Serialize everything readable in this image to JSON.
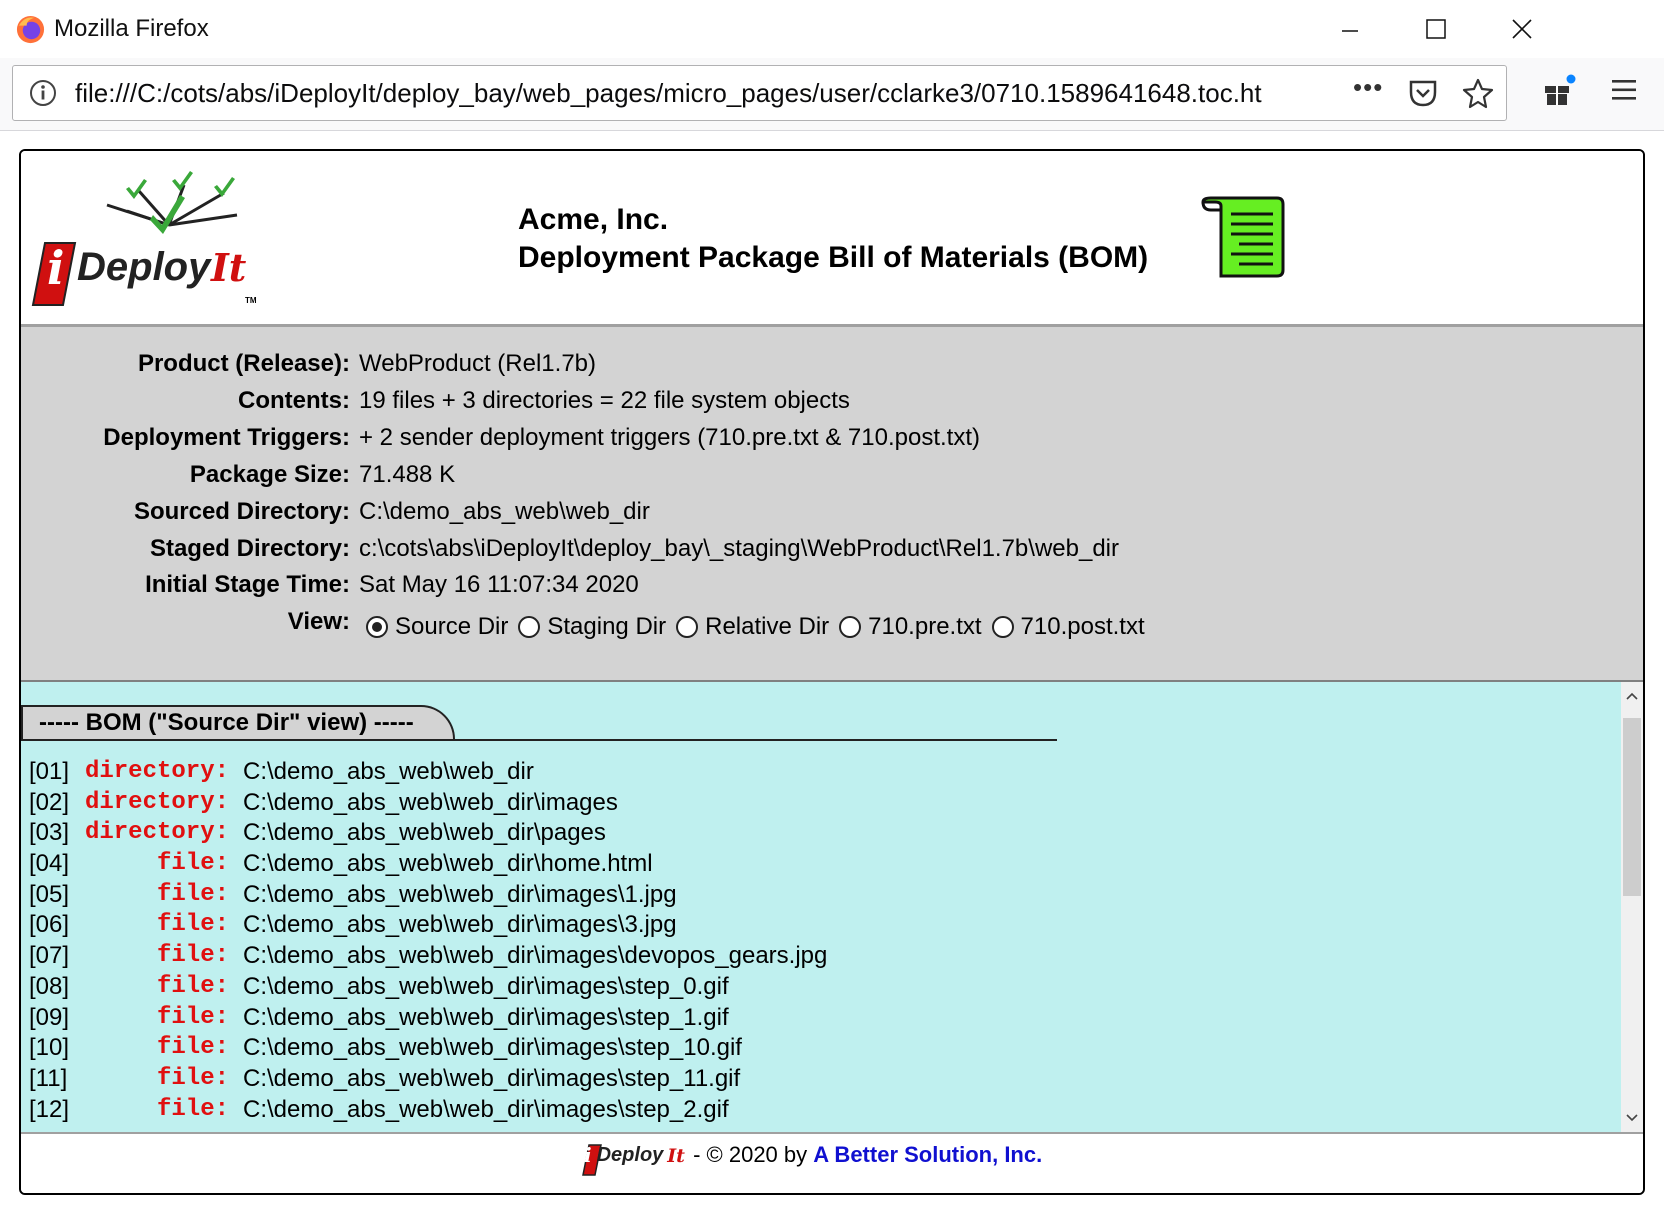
{
  "window": {
    "title": "Mozilla Firefox"
  },
  "urlbar": {
    "url": "file:///C:/cots/abs/iDeployIt/deploy_bay/web_pages/micro_pages/user/cclarke3/0710.1589641648.toc.ht",
    "more": "•••"
  },
  "header": {
    "logo_text_i": "i",
    "logo_text_deploy": "Deploy",
    "logo_text_it": "It",
    "logo_tm": "TM",
    "company": "Acme, Inc.",
    "subtitle": "Deployment Package Bill of Materials (BOM)"
  },
  "info": [
    {
      "label": "Product (Release):",
      "value": "WebProduct (Rel1.7b)"
    },
    {
      "label": "Contents:",
      "value": "19 files + 3 directories = 22 file system objects"
    },
    {
      "label": "Deployment Triggers:",
      "value": "+ 2 sender deployment triggers (710.pre.txt & 710.post.txt)"
    },
    {
      "label": "Package Size:",
      "value": "71.488 K"
    },
    {
      "label": "Sourced Directory:",
      "value": "C:\\demo_abs_web\\web_dir"
    },
    {
      "label": "Staged Directory:",
      "value": "c:\\cots\\abs\\iDeployIt\\deploy_bay\\_staging\\WebProduct\\Rel1.7b\\web_dir"
    },
    {
      "label": "Initial Stage Time:",
      "value": "Sat May 16 11:07:34 2020"
    }
  ],
  "view": {
    "label": "View:",
    "selected": "Source Dir",
    "options": [
      "Source Dir",
      "Staging Dir",
      "Relative Dir",
      "710.pre.txt",
      "710.post.txt"
    ]
  },
  "bom": {
    "tab_title": "----- BOM (\"Source Dir\" view) -----",
    "rows": [
      {
        "idx": "[01]",
        "kind": "directory:",
        "path": "C:\\demo_abs_web\\web_dir"
      },
      {
        "idx": "[02]",
        "kind": "directory:",
        "path": "C:\\demo_abs_web\\web_dir\\images"
      },
      {
        "idx": "[03]",
        "kind": "directory:",
        "path": "C:\\demo_abs_web\\web_dir\\pages"
      },
      {
        "idx": "[04]",
        "kind": "file:",
        "path": "C:\\demo_abs_web\\web_dir\\home.html"
      },
      {
        "idx": "[05]",
        "kind": "file:",
        "path": "C:\\demo_abs_web\\web_dir\\images\\1.jpg"
      },
      {
        "idx": "[06]",
        "kind": "file:",
        "path": "C:\\demo_abs_web\\web_dir\\images\\3.jpg"
      },
      {
        "idx": "[07]",
        "kind": "file:",
        "path": "C:\\demo_abs_web\\web_dir\\images\\devopos_gears.jpg"
      },
      {
        "idx": "[08]",
        "kind": "file:",
        "path": "C:\\demo_abs_web\\web_dir\\images\\step_0.gif"
      },
      {
        "idx": "[09]",
        "kind": "file:",
        "path": "C:\\demo_abs_web\\web_dir\\images\\step_1.gif"
      },
      {
        "idx": "[10]",
        "kind": "file:",
        "path": "C:\\demo_abs_web\\web_dir\\images\\step_10.gif"
      },
      {
        "idx": "[11]",
        "kind": "file:",
        "path": "C:\\demo_abs_web\\web_dir\\images\\step_11.gif"
      },
      {
        "idx": "[12]",
        "kind": "file:",
        "path": "C:\\demo_abs_web\\web_dir\\images\\step_2.gif"
      }
    ]
  },
  "footer": {
    "logo_i": "i",
    "logo_deploy": "Deploy",
    "logo_it": "It",
    "copyright": " - © 2020 by ",
    "link": "A Better Solution, Inc."
  },
  "colors": {
    "info_bg": "#d3d3d3",
    "bom_bg": "#bff0ef",
    "kind_red": "#e01010",
    "link_blue": "#1010d0",
    "logo_red": "#d01010",
    "scroll_green": "#66ee22"
  },
  "icons": [
    "firefox-icon",
    "minimize-icon",
    "maximize-icon",
    "close-icon",
    "info-icon",
    "pocket-icon",
    "star-icon",
    "gift-icon",
    "hamburger-menu-icon",
    "checkmark-tree-icon",
    "document-scroll-icon",
    "scroll-up-icon",
    "scroll-down-icon"
  ]
}
